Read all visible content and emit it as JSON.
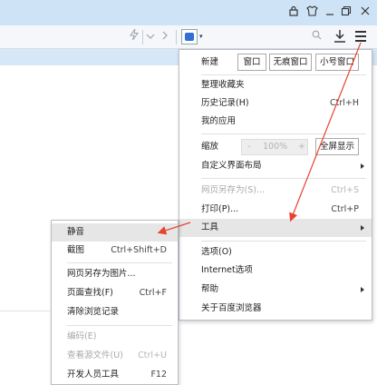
{
  "toolbar": {
    "menu_button_icon": "hamburger-icon"
  },
  "main_menu": {
    "row_new": {
      "label": "新建",
      "window_label": "窗口",
      "incognito_label": "无痕窗口",
      "small_window_label": "小号窗口"
    },
    "items_group1": [
      {
        "label": "整理收藏夹",
        "shortcut": ""
      },
      {
        "label": "历史记录(H)",
        "shortcut": "Ctrl+H"
      },
      {
        "label": "我的应用",
        "shortcut": ""
      }
    ],
    "zoom": {
      "label": "缩放",
      "minus": "-",
      "value": "100%",
      "plus": "+",
      "fullscreen_label": "全屏显示"
    },
    "customize": {
      "label": "自定义界面布局"
    },
    "save_as": {
      "label": "网页另存为(S)...",
      "shortcut": "Ctrl+S"
    },
    "print": {
      "label": "打印(P)...",
      "shortcut": "Ctrl+P"
    },
    "tools": {
      "label": "工具"
    },
    "options": {
      "label": "选项(O)"
    },
    "internet_options": {
      "label": "Internet选项"
    },
    "help": {
      "label": "帮助"
    },
    "about": {
      "label": "关于百度浏览器"
    }
  },
  "tools_submenu": {
    "mute": {
      "label": "静音"
    },
    "screenshot": {
      "label": "截图",
      "shortcut": "Ctrl+Shift+D"
    },
    "save_as_image": {
      "label": "网页另存为图片..."
    },
    "find": {
      "label": "页面查找(F)",
      "shortcut": "Ctrl+F"
    },
    "clear_history": {
      "label": "清除浏览记录"
    },
    "encoding": {
      "label": "编码(E)"
    },
    "view_source": {
      "label": "查看源文件(U)",
      "shortcut": "Ctrl+U"
    },
    "devtools": {
      "label": "开发人员工具",
      "shortcut": "F12"
    }
  },
  "colors": {
    "annotation_arrow": "#e8432f",
    "highlight": "#e6e6e6",
    "titlebar": "#cfe3f7"
  }
}
